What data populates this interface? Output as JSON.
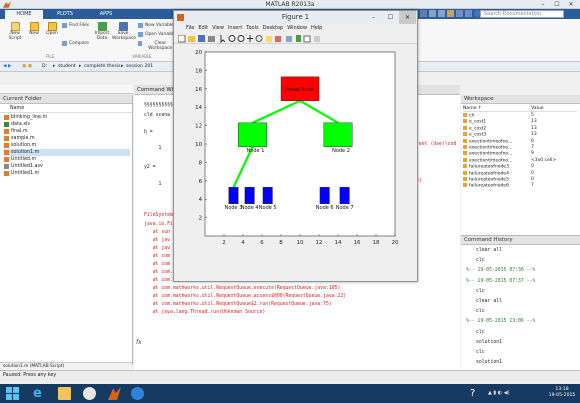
{
  "window_title": "MATLAB R2013a",
  "ribbon_tabs": [
    "HOME",
    "PLOTS",
    "APPS"
  ],
  "search_placeholder": "Search Documentation",
  "ribbon": {
    "new_script": "New Script",
    "new": "New",
    "open": "Open",
    "find_files": "Find Files",
    "compare": "Compare",
    "import_data": "Import Data",
    "save_workspace": "Save Workspace",
    "new_variable": "New Variable",
    "open_variable": "Open Variable",
    "clear_workspace": "Clear Workspace",
    "section_file": "FILE",
    "section_variable": "VARIABLE"
  },
  "path": [
    "D:",
    "student",
    "complete thesis",
    "session 201"
  ],
  "current_folder": {
    "title": "Current Folder",
    "col_name": "Name",
    "files": [
      "blinking_line.m",
      "data.xls",
      "final.m",
      "sample.m",
      "solution.m",
      "solution1.m",
      "Untitled.m",
      "Untitled1.asv",
      "Untitled1.m"
    ],
    "selected_index": 5,
    "details": "solution1.m (MATLAB Script)"
  },
  "command_window": {
    "title": "Command Window",
    "lines": [
      {
        "t": "§§§§§§§§§§",
        "err": false
      },
      {
        "t": "cld scena",
        "err": false
      },
      {
        "t": "h =",
        "err": false
      },
      {
        "t": "     1",
        "err": false
      },
      {
        "t": "y2 =",
        "err": false
      },
      {
        "t": "     1",
        "err": false
      },
      {
        "t": "FileSystem",
        "err": true
      },
      {
        "t": "java.io.Fi",
        "err": true
      },
      {
        "t": "   at sun",
        "err": true
      },
      {
        "t": "   at jav",
        "err": true
      },
      {
        "t": "   at jav",
        "err": true
      },
      {
        "t": "   at com",
        "err": true
      },
      {
        "t": "   at com",
        "err": true
      },
      {
        "t": "   at com.mathworks.mlwidgets.explorer.extensions.basic.DefaultFileInfoProvider$1.run(Default",
        "err": true
      },
      {
        "t": "   at com.mathworks.mlwidgets.explorer.model.FileDecoration$4391.run(FileDecorationModel.",
        "err": true
      },
      {
        "t": "   at com.mathworks.util.RequestQueue.execute(RequestQueue.java:105)",
        "err": true
      },
      {
        "t": "   at com.mathworks.util.RequestQueue.access$000(RequestQueue.java:22)",
        "err": true
      },
      {
        "t": "   at com.mathworks.util.RequestQueue$2.run(RequestQueue.java:75)",
        "err": true
      },
      {
        "t": "   at java.lang.Thread.run(Unknown Source)",
        "err": true
      }
    ],
    "right_fragments": [
      "reet (doe)\\cod",
      "2)"
    ],
    "prompt": "fx"
  },
  "workspace": {
    "title": "Workspace",
    "col_name": "Name ↑",
    "col_value": "Value",
    "rows": [
      {
        "n": "ch",
        "v": "5"
      },
      {
        "n": "e_cost1",
        "v": "13"
      },
      {
        "n": "e_cost2",
        "v": "13"
      },
      {
        "n": "e_cost3",
        "v": "13"
      },
      {
        "n": "exectiontimeofno...",
        "v": "6"
      },
      {
        "n": "exectiontimeofno...",
        "v": "7"
      },
      {
        "n": "exectiontimeofno...",
        "v": "9"
      },
      {
        "n": "exectiontimeofno...",
        "v": "<3x0 cell>"
      },
      {
        "n": "failureateofnode3",
        "v": "0"
      },
      {
        "n": "failureateofnode4",
        "v": "0"
      },
      {
        "n": "failureateofnode5",
        "v": "0"
      },
      {
        "n": "failureateofnode6",
        "v": "7"
      }
    ]
  },
  "history": {
    "title": "Command History",
    "lines": [
      {
        "t": "clear all",
        "kind": "cmd"
      },
      {
        "t": "clc",
        "kind": "cmd"
      },
      {
        "t": "%-- 19-05-2015 07:36 --%",
        "kind": "stamp"
      },
      {
        "t": "%-- 19-05-2015 07:37 --%",
        "kind": "stamp"
      },
      {
        "t": "clc",
        "kind": "cmd"
      },
      {
        "t": "clear all",
        "kind": "cmd"
      },
      {
        "t": "clc",
        "kind": "cmd"
      },
      {
        "t": "%-- 19-05-2015 13:06 --%",
        "kind": "stamp"
      },
      {
        "t": "clc",
        "kind": "cmd"
      },
      {
        "t": "solution1",
        "kind": "cmd"
      },
      {
        "t": "clc",
        "kind": "cmd"
      },
      {
        "t": "solution1",
        "kind": "cmd"
      }
    ]
  },
  "status": "Paused: Press any key",
  "taskbar": {
    "time": "13:18",
    "date": "19-05-2015"
  },
  "figure": {
    "title": "Figure 1",
    "menu": [
      "File",
      "Edit",
      "View",
      "Insert",
      "Tools",
      "Desktop",
      "Window",
      "Help"
    ]
  },
  "chart_data": {
    "type": "scatter",
    "xlim": [
      0,
      20
    ],
    "ylim": [
      0,
      20
    ],
    "xticks": [
      2,
      4,
      6,
      8,
      10,
      12,
      14,
      16,
      18,
      20
    ],
    "yticks": [
      2,
      4,
      6,
      8,
      10,
      12,
      14,
      16,
      18,
      20
    ],
    "nodes": [
      {
        "label": "Head Node",
        "x": 10,
        "y": 16,
        "w": 4,
        "h": 2.6,
        "color": "#ff0000"
      },
      {
        "label": "Node 1",
        "x": 5,
        "y": 11,
        "w": 3,
        "h": 2.6,
        "color": "#00ff00"
      },
      {
        "label": "Node 2",
        "x": 14,
        "y": 11,
        "w": 3,
        "h": 2.6,
        "color": "#00ff00"
      },
      {
        "label": "Node 3",
        "x": 3,
        "y": 4.4,
        "w": 1,
        "h": 1.8,
        "color": "#0000ff"
      },
      {
        "label": "Node 4",
        "x": 4.7,
        "y": 4.4,
        "w": 1,
        "h": 1.8,
        "color": "#0000ff"
      },
      {
        "label": "Node 5",
        "x": 6.6,
        "y": 4.4,
        "w": 1,
        "h": 1.8,
        "color": "#0000ff"
      },
      {
        "label": "Node 6",
        "x": 12.6,
        "y": 4.4,
        "w": 1,
        "h": 1.8,
        "color": "#0000ff"
      },
      {
        "label": "Node 7",
        "x": 14.7,
        "y": 4.4,
        "w": 1,
        "h": 1.8,
        "color": "#0000ff"
      }
    ],
    "links": [
      {
        "from": [
          10,
          14.7
        ],
        "to": [
          5,
          12.3
        ],
        "color": "#00ff00"
      },
      {
        "from": [
          10,
          14.7
        ],
        "to": [
          14,
          12.3
        ],
        "color": "#00ff00"
      },
      {
        "from": [
          5,
          9.7
        ],
        "to": [
          3,
          5.3
        ],
        "color": "#00ff00"
      }
    ]
  },
  "colors": {
    "accent": "#2a5d9a",
    "error": "#e21b1b",
    "taskbar": "#173a62"
  }
}
